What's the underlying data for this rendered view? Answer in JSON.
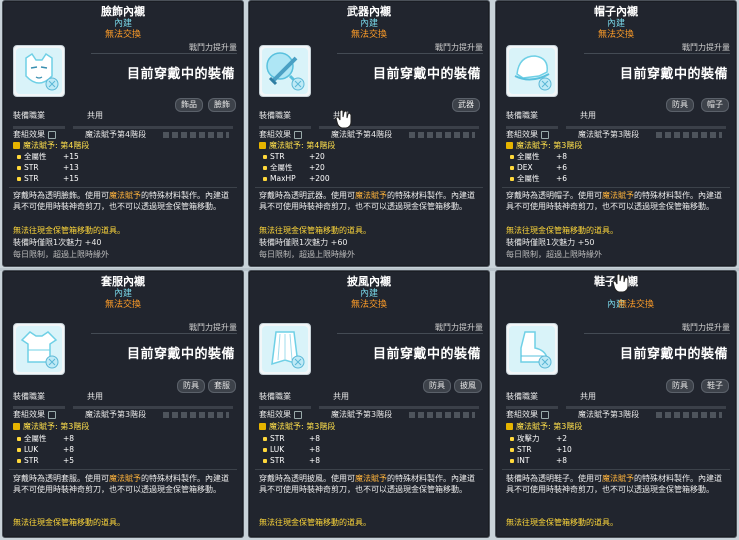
{
  "common": {
    "equipped": "目前穿戴中的裝備",
    "combat_power": "戰鬥力提升量",
    "job_label": "裝備職業",
    "job_value": "共用",
    "set_label": "套組效果",
    "magic_text": "魔法賦予: 第3階段",
    "magic_text_4": "魔法賦予: 第4階段",
    "trade": "無法交換",
    "grade": "內建",
    "warn": "無法往現金保管箱移動的道具。"
  },
  "cards": [
    {
      "title": "臉飾內襯",
      "tags": [
        "飾品",
        "臉飾"
      ],
      "set_value": "魔法賦予第4階段",
      "stats": [
        {
          "name": "全屬性",
          "value": "+15"
        },
        {
          "name": "STR",
          "value": "+13"
        },
        {
          "name": "STR",
          "value": "+15"
        }
      ],
      "desc_a": "穿戴時為透明臉飾。使用可",
      "desc_hl": "魔法賦予",
      "desc_b": "的特殊材料製作。內建道具不可使用時裝神奇剪刀，也不可以透過現金保管箱移動。",
      "bonus": "裝備時僅限1次魅力 +40",
      "daily": "每日限制，超過上限時緣外"
    },
    {
      "title": "武器內襯",
      "tags": [
        "武器"
      ],
      "set_value": "魔法賦予第4階段",
      "stats": [
        {
          "name": "STR",
          "value": "+20"
        },
        {
          "name": "全屬性",
          "value": "+20"
        },
        {
          "name": "MaxHP",
          "value": "+200"
        }
      ],
      "desc_a": "穿戴時為透明武器。使用可",
      "desc_hl": "魔法賦予",
      "desc_b": "的特殊材料製作。內建道具不可使用時裝神奇剪刀，也不可以透過現金保管箱移動。",
      "bonus": "裝備時僅限1次魅力 +60",
      "daily": "每日限制，超過上限時緣外"
    },
    {
      "title": "帽子內襯",
      "tags": [
        "防具",
        "帽子"
      ],
      "set_value": "魔法賦予第3階段",
      "stats": [
        {
          "name": "全屬性",
          "value": "+8"
        },
        {
          "name": "DEX",
          "value": "+6"
        },
        {
          "name": "全屬性",
          "value": "+6"
        }
      ],
      "desc_a": "穿戴時為透明帽子。使用可",
      "desc_hl": "魔法賦予",
      "desc_b": "的特殊材料製作。內建道具不可使用時裝神奇剪刀，也不可以透過現金保管箱移動。",
      "bonus": "裝備時僅限1次魅力 +50",
      "daily": "每日限制，超過上限時緣外"
    },
    {
      "title": "套服內襯",
      "tags": [
        "防具",
        "套服"
      ],
      "set_value": "魔法賦予第3階段",
      "stats": [
        {
          "name": "全屬性",
          "value": "+8"
        },
        {
          "name": "LUK",
          "value": "+8"
        },
        {
          "name": "STR",
          "value": "+5"
        }
      ],
      "desc_a": "穿戴時為透明套服。使用可",
      "desc_hl": "魔法賦予",
      "desc_b": "的特殊材料製作。內建道具不可使用時裝神奇剪刀，也不可以透過現金保管箱移動。"
    },
    {
      "title": "披風內襯",
      "tags": [
        "防具",
        "披風"
      ],
      "set_value": "魔法賦予第3階段",
      "stats": [
        {
          "name": "STR",
          "value": "+8"
        },
        {
          "name": "LUK",
          "value": "+8"
        },
        {
          "name": "STR",
          "value": "+8"
        }
      ],
      "desc_a": "穿戴時為透明披風。使用可",
      "desc_hl": "魔法賦予",
      "desc_b": "的特殊材料製作。內建道具不可使用時裝神奇剪刀，也不可以透過現金保管箱移動。"
    },
    {
      "title": "鞋子內襯",
      "tags": [
        "防具",
        "鞋子"
      ],
      "set_value": "魔法賦予第3階段",
      "stats": [
        {
          "name": "攻擊力",
          "value": "+2"
        },
        {
          "name": "STR",
          "value": "+10"
        },
        {
          "name": "INT",
          "value": "+8"
        }
      ],
      "desc_a": "裝備時為透明鞋子。使用可",
      "desc_hl": "魔法賦予",
      "desc_b": "的特殊材料製作。內建道具不可使用時裝神奇剪刀，也不可以透過現金保管箱移動。"
    }
  ]
}
